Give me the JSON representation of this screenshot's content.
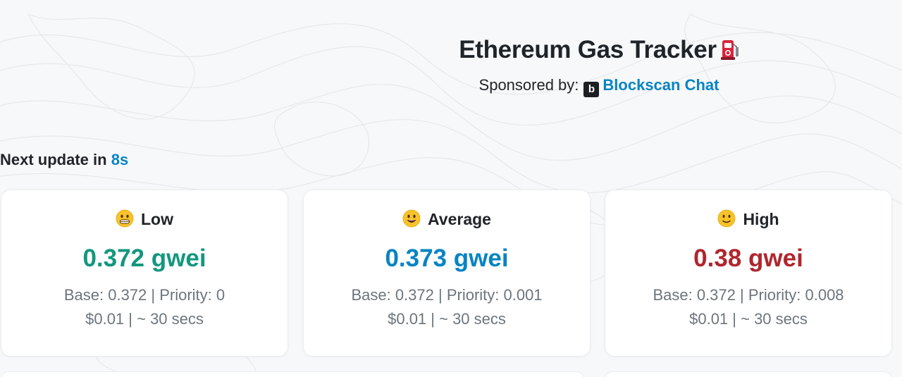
{
  "header": {
    "title": "Ethereum Gas Tracker",
    "title_icon": "fuel-pump-icon",
    "sponsor_label": "Sponsored by:",
    "sponsor_logo_letter": "b",
    "sponsor_name": "Blockscan Chat"
  },
  "update": {
    "prefix": "Next update in",
    "seconds": "8s"
  },
  "colors": {
    "low": "#13977f",
    "average": "#0784c3",
    "high": "#b0262d",
    "link": "#0784c3"
  },
  "cards": {
    "low": {
      "icon": "grinning-face-icon",
      "label": "Low",
      "price": "0.372 gwei",
      "base_priority": "Base: 0.372 | Priority: 0",
      "cost_time": "$0.01 | ~ 30 secs"
    },
    "average": {
      "icon": "smiling-face-icon",
      "label": "Average",
      "price": "0.373 gwei",
      "base_priority": "Base: 0.372 | Priority: 0.001",
      "cost_time": "$0.01 | ~ 30 secs"
    },
    "high": {
      "icon": "slightly-smiling-face-icon",
      "label": "High",
      "price": "0.38 gwei",
      "base_priority": "Base: 0.372 | Priority: 0.008",
      "cost_time": "$0.01 | ~ 30 secs"
    }
  }
}
